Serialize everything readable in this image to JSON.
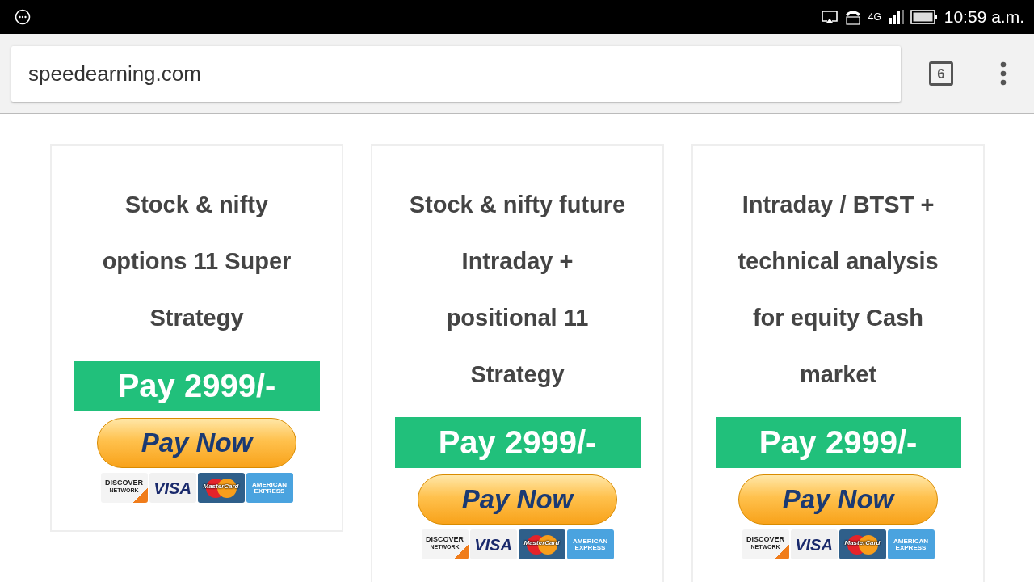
{
  "status_bar": {
    "network": "4G",
    "time": "10:59 a.m."
  },
  "address_bar": {
    "url": "speedearning.com",
    "tab_count": "6"
  },
  "plans": [
    {
      "title_lines": [
        "Stock & nifty",
        "options 11 Super",
        "Strategy"
      ],
      "price": "Pay 2999/-",
      "button": "Pay Now",
      "cards": [
        {
          "kind": "discover",
          "label": "DISCOVER",
          "sub": "NETWORK"
        },
        {
          "kind": "visa",
          "label": "VISA"
        },
        {
          "kind": "mastercard",
          "label": "MasterCard"
        },
        {
          "kind": "amex",
          "label": "AMERICAN",
          "sub": "EXPRESS"
        }
      ]
    },
    {
      "title_lines": [
        "Stock & nifty future",
        "Intraday +",
        "positional 11",
        "Strategy"
      ],
      "price": "Pay 2999/-",
      "button": "Pay Now",
      "cards": [
        {
          "kind": "discover",
          "label": "DISCOVER",
          "sub": "NETWORK"
        },
        {
          "kind": "visa",
          "label": "VISA"
        },
        {
          "kind": "mastercard",
          "label": "MasterCard"
        },
        {
          "kind": "amex",
          "label": "AMERICAN",
          "sub": "EXPRESS"
        }
      ]
    },
    {
      "title_lines": [
        "Intraday / BTST +",
        "technical analysis",
        "for equity Cash",
        "market"
      ],
      "price": "Pay 2999/-",
      "button": "Pay Now",
      "cards": [
        {
          "kind": "discover",
          "label": "DISCOVER",
          "sub": "NETWORK"
        },
        {
          "kind": "visa",
          "label": "VISA"
        },
        {
          "kind": "mastercard",
          "label": "MasterCard"
        },
        {
          "kind": "amex",
          "label": "AMERICAN",
          "sub": "EXPRESS"
        }
      ]
    }
  ]
}
